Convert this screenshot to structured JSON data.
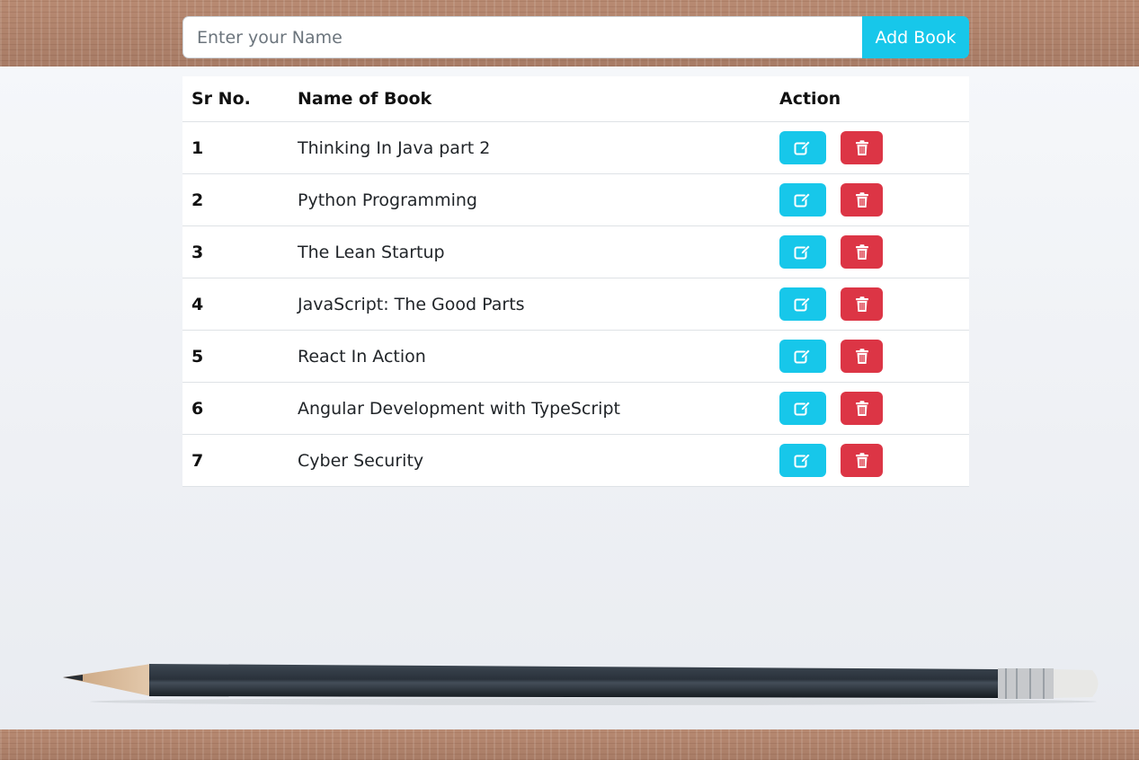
{
  "form": {
    "placeholder": "Enter your Name",
    "value": "",
    "add_label": "Add Book"
  },
  "table": {
    "headers": {
      "sr": "Sr No.",
      "name": "Name of Book",
      "action": "Action"
    },
    "rows": [
      {
        "sr": "1",
        "name": "Thinking In Java part 2"
      },
      {
        "sr": "2",
        "name": "Python Programming"
      },
      {
        "sr": "3",
        "name": "The Lean Startup"
      },
      {
        "sr": "4",
        "name": "JavaScript: The Good Parts"
      },
      {
        "sr": "5",
        "name": "React In Action"
      },
      {
        "sr": "6",
        "name": "Angular Development with TypeScript"
      },
      {
        "sr": "7",
        "name": "Cyber Security"
      }
    ]
  },
  "icons": {
    "edit": "edit-icon",
    "delete": "trash-icon"
  },
  "colors": {
    "primary": "#17c7ea",
    "danger": "#dc3545"
  }
}
